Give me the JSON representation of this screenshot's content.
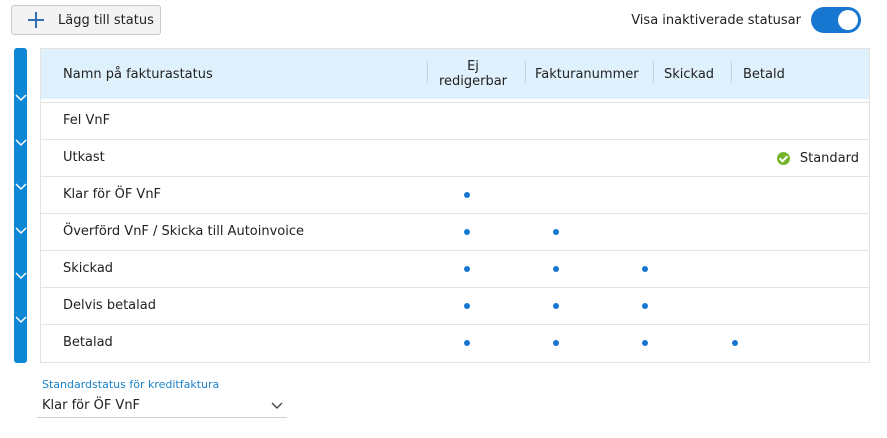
{
  "toolbar": {
    "add_status_label": "Lägg till status"
  },
  "toggle": {
    "label": "Visa inaktiverade statusar",
    "state": "on",
    "color": "#1676d0"
  },
  "table": {
    "headers": {
      "name": "Namn på fakturastatus",
      "ej_line1": "Ej",
      "ej_line2": "redigerbar",
      "fakturanummer": "Fakturanummer",
      "skickad": "Skickad",
      "betald": "Betald"
    },
    "rows": [
      {
        "name": "Fel VnF",
        "ej_redigerbar": false,
        "fakturanummer": false,
        "skickad": false,
        "betald": false,
        "default": ""
      },
      {
        "name": "Utkast",
        "ej_redigerbar": false,
        "fakturanummer": false,
        "skickad": false,
        "betald": false,
        "default": "Standard"
      },
      {
        "name": "Klar för ÖF VnF",
        "ej_redigerbar": true,
        "fakturanummer": false,
        "skickad": false,
        "betald": false,
        "default": ""
      },
      {
        "name": "Överförd VnF / Skicka till Autoinvoice",
        "ej_redigerbar": true,
        "fakturanummer": true,
        "skickad": false,
        "betald": false,
        "default": ""
      },
      {
        "name": "Skickad",
        "ej_redigerbar": true,
        "fakturanummer": true,
        "skickad": true,
        "betald": false,
        "default": ""
      },
      {
        "name": "Delvis betalad",
        "ej_redigerbar": true,
        "fakturanummer": true,
        "skickad": true,
        "betald": false,
        "default": ""
      },
      {
        "name": "Betalad",
        "ej_redigerbar": true,
        "fakturanummer": true,
        "skickad": true,
        "betald": true,
        "default": ""
      }
    ]
  },
  "credit_default": {
    "label": "Standardstatus för kreditfaktura",
    "value": "Klar för ÖF VnF"
  },
  "colors": {
    "accent": "#1676d0",
    "rail": "#0e87d6",
    "header_bg": "#dff1fd",
    "check": "#74b42a",
    "link": "#1b82c9"
  },
  "icons": {
    "add": "plus-icon",
    "default_marker": "check-circle-icon",
    "rail": "chevron-down-icon",
    "dropdown": "chevron-down-icon"
  }
}
